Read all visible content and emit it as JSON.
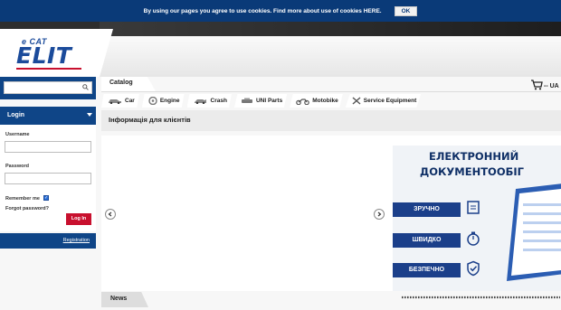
{
  "cookie": {
    "message": "By using our pages you agree to use cookies. Find more about use of cookies HERE.",
    "ok_label": "OK"
  },
  "brand": {
    "tagline": "e CAT",
    "name": "ELIT",
    "accent": "#1b4b9b",
    "red": "#c8102e"
  },
  "search": {
    "placeholder": "",
    "value": ""
  },
  "login": {
    "title": "Login",
    "username_label": "Username",
    "password_label": "Password",
    "remember_label": "Remember me",
    "remember_checked": true,
    "forgot_label": "Forgot password?",
    "login_button": "Log In",
    "registration_label": "Registration"
  },
  "catalog": {
    "tab_label": "Catalog",
    "lang_label": "-- UA",
    "items": [
      {
        "label": "Car",
        "icon": "car-icon"
      },
      {
        "label": "Engine",
        "icon": "engine-icon"
      },
      {
        "label": "Crash",
        "icon": "crash-car-icon"
      },
      {
        "label": "UNI Parts",
        "icon": "uni-parts-icon"
      },
      {
        "label": "Motobike",
        "icon": "motorbike-icon"
      },
      {
        "label": "Service Equipment",
        "icon": "tools-icon"
      }
    ]
  },
  "info": {
    "title": "Інформація для клієнтів"
  },
  "banner": {
    "line1": "ЕЛЕКТРОННИЙ",
    "line2": "ДОКУМЕНТООБІГ",
    "features": [
      "ЗРУЧНО",
      "ШВИДКО",
      "БЕЗПЕЧНО"
    ]
  },
  "news": {
    "tab_label": "News"
  }
}
